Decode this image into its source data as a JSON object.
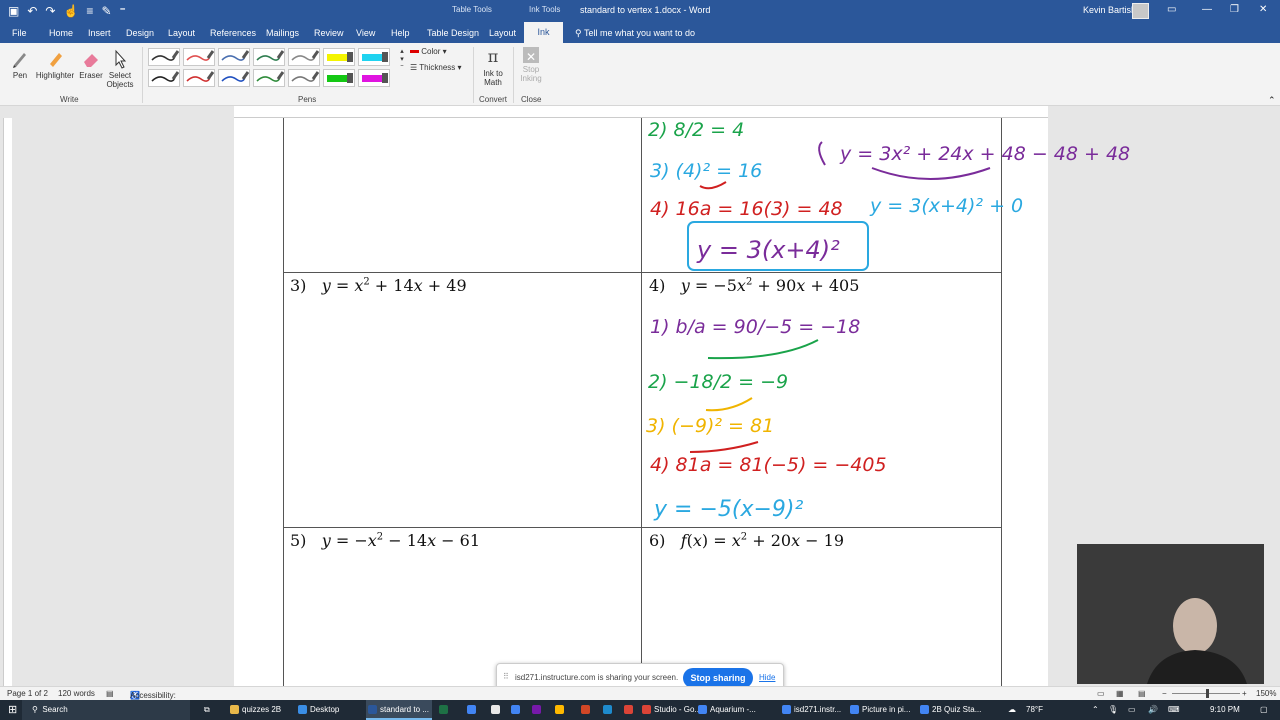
{
  "titlebar": {
    "ctx_table_tools": "Table Tools",
    "ctx_ink_tools": "Ink Tools",
    "doc_title": "standard to vertex 1.docx  -  Word",
    "user_name": "Kevin Bartish"
  },
  "tabs": [
    "File",
    "Home",
    "Insert",
    "Design",
    "Layout",
    "References",
    "Mailings",
    "Review",
    "View",
    "Help",
    "Table Design",
    "Layout"
  ],
  "active_tab": "Ink",
  "tellme": "Tell me what you want to do",
  "ribbon": {
    "write": {
      "pen": "Pen",
      "highlighter": "Highlighter",
      "eraser": "Eraser",
      "select_objects": "Select Objects",
      "group": "Write"
    },
    "pens": {
      "color": "Color",
      "thickness": "Thickness",
      "group": "Pens"
    },
    "convert": {
      "ink_to_math": "Ink to Math",
      "group": "Convert"
    },
    "close": {
      "stop_inking": "Stop Inking",
      "group": "Close"
    },
    "pen_colors": [
      "#333333",
      "#e05050",
      "#4a6fb0",
      "#2e7d4f",
      "#888888",
      "#f4f400",
      "#1fd3f0",
      "#222222",
      "#d03030",
      "#2050c0",
      "#2e8b3a",
      "#777777",
      "#14c814",
      "#e014e0"
    ]
  },
  "problems": [
    {
      "num": "3)",
      "expr_html": "<i>y</i> = <i>x</i><sup>2</sup> + 14<i>x</i> + 49"
    },
    {
      "num": "4)",
      "expr_html": "<i>y</i> = −5<i>x</i><sup>2</sup> + 90<i>x</i> + 405"
    },
    {
      "num": "5)",
      "expr_html": "<i>y</i> = −<i>x</i><sup>2</sup> − 14<i>x</i> − 61"
    },
    {
      "num": "6)",
      "expr_html": "<i>f</i>(<i>x</i>) = <i>x</i><sup>2</sup> + 20<i>x</i> − 19"
    }
  ],
  "ink": {
    "top": [
      "2) 8/2 = 4",
      "3) (4)² = 16",
      "4) 16a = 16(3) = 48",
      "y = 3(x+4)²",
      "y = 3x² + 24x + 48 − 48 + 48",
      "y = 3(x+4)² + 0"
    ],
    "p4": [
      "1) b/a = 90/−5 = −18",
      "2) −18/2 = −9",
      "3) (−9)² = 81",
      "4) 81a = 81(−5) = −405",
      "y = −5(x−9)²"
    ]
  },
  "status": {
    "page": "Page 1 of 2",
    "words": "120 words",
    "accessibility": "Accessibility: Investigate",
    "zoom": "150%"
  },
  "sharing": {
    "text": "isd271.instructure.com is sharing your screen.",
    "stop": "Stop sharing",
    "hide": "Hide"
  },
  "taskbar": {
    "search": "Search",
    "items": [
      {
        "label": "quizzes 2B",
        "color": "#e8b84a"
      },
      {
        "label": "Desktop",
        "color": "#3a8ee6"
      },
      {
        "label": "standard to ...",
        "color": "#2b579a"
      },
      {
        "label": "Studio - Go...",
        "color": "#db4437"
      },
      {
        "label": "Aquarium -...",
        "color": "#4285f4"
      },
      {
        "label": "isd271.instr...",
        "color": "#4285f4"
      },
      {
        "label": "Picture in pi...",
        "color": "#4285f4"
      },
      {
        "label": "2B Quiz Sta...",
        "color": "#4285f4"
      }
    ],
    "weather": "78°F",
    "time": "9:10 PM"
  }
}
